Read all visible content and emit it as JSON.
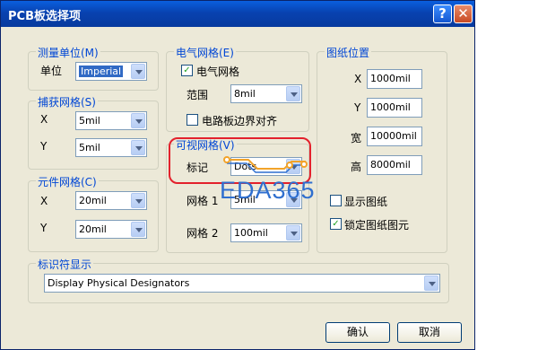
{
  "window": {
    "title": "PCB板选择项",
    "help_icon": "?",
    "close_icon": "✕"
  },
  "units": {
    "legend": "测量单位(M)",
    "label": "单位",
    "value": "Imperial"
  },
  "snap": {
    "legend": "捕获网格(S)",
    "x_label": "X",
    "x_value": "5mil",
    "y_label": "Y",
    "y_value": "5mil"
  },
  "component": {
    "legend": "元件网格(C)",
    "x_label": "X",
    "x_value": "20mil",
    "y_label": "Y",
    "y_value": "20mil"
  },
  "electrical": {
    "legend": "电气网格(E)",
    "checkbox_label": "电气网格",
    "range_label": "范围",
    "range_value": "8mil",
    "edge_label": "电路板边界对齐"
  },
  "visible": {
    "legend": "可视网格(V)",
    "marker_label": "标记",
    "marker_value": "Dots",
    "grid1_label": "网格 1",
    "grid1_value": "5mil",
    "grid2_label": "网格 2",
    "grid2_value": "100mil"
  },
  "sheet": {
    "legend": "图纸位置",
    "x_label": "X",
    "x_value": "1000mil",
    "y_label": "Y",
    "y_value": "1000mil",
    "width_label": "宽",
    "width_value": "10000mil",
    "height_label": "高",
    "height_value": "8000mil",
    "show_sheet_label": "显示图纸",
    "lock_label": "锁定图纸图元"
  },
  "designator": {
    "legend": "标识符显示",
    "value": "Display Physical Designators"
  },
  "buttons": {
    "ok": "确认",
    "cancel": "取消"
  },
  "watermark": {
    "text": "EDA365"
  }
}
